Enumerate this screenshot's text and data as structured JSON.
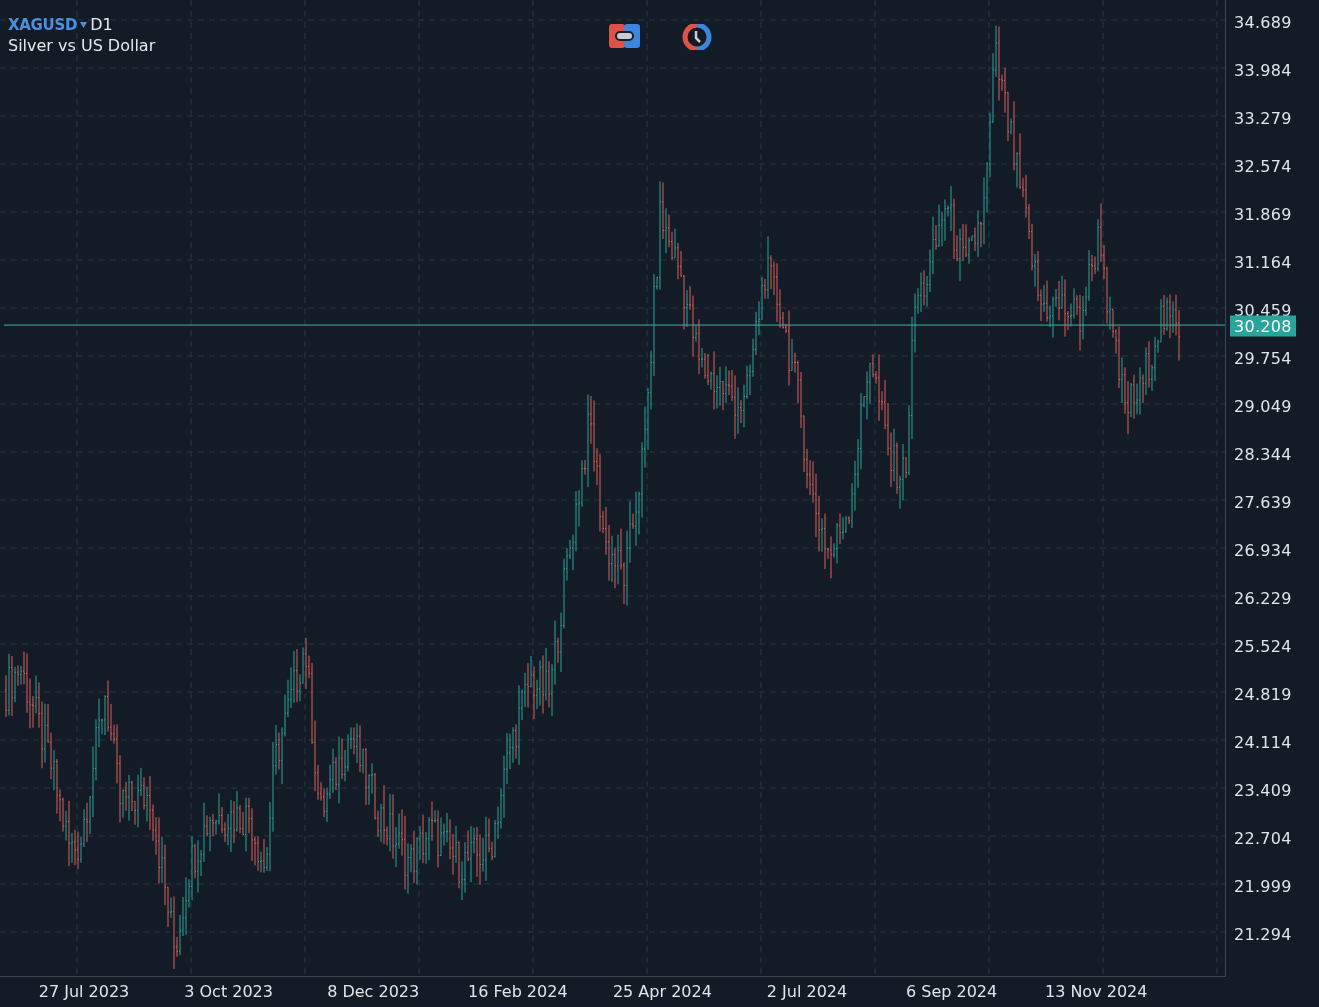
{
  "header": {
    "symbol": "XAGUSD",
    "timeframe": "D1",
    "description": "Silver vs US Dollar"
  },
  "price_axis": {
    "ticks": [
      "34.689",
      "33.984",
      "33.279",
      "32.574",
      "31.869",
      "31.164",
      "30.459",
      "29.754",
      "29.049",
      "28.344",
      "27.639",
      "26.934",
      "26.229",
      "25.524",
      "24.819",
      "24.114",
      "23.409",
      "22.704",
      "21.999",
      "21.294"
    ],
    "current_price": "30.208"
  },
  "date_axis": {
    "labels": [
      "27 Jul 2023",
      "3 Oct 2023",
      "8 Dec 2023",
      "16 Feb 2024",
      "25 Apr 2024",
      "2 Jul 2024",
      "6 Sep 2024",
      "13 Nov 2024"
    ]
  }
}
